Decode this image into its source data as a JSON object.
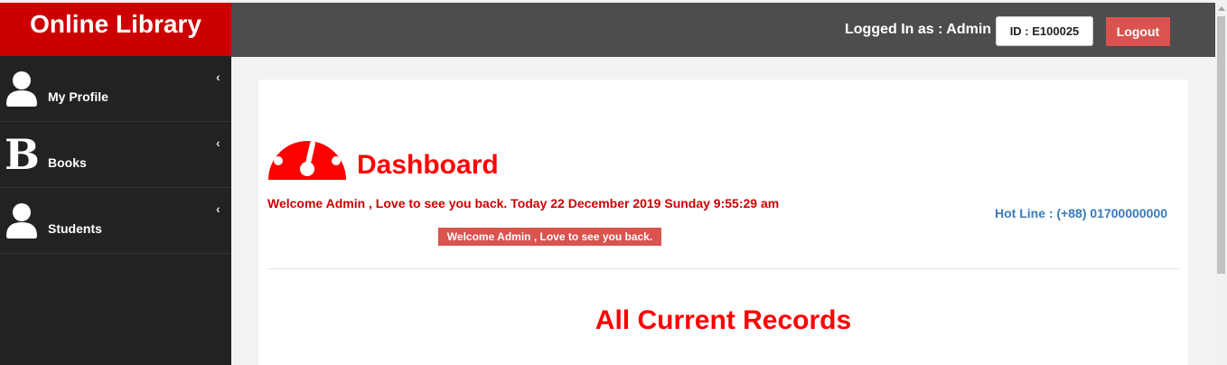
{
  "brand": {
    "title": "Online Library"
  },
  "header": {
    "logged_in_text": "Logged In as : Admin",
    "id_text": "ID : E100025",
    "logout_label": "Logout"
  },
  "sidebar": {
    "items": [
      {
        "label": "My Profile",
        "icon": "user-icon"
      },
      {
        "label": "Books",
        "icon": "b-letter-icon"
      },
      {
        "label": "Students",
        "icon": "user-icon"
      }
    ]
  },
  "main": {
    "dashboard_title": "Dashboard",
    "welcome_line": "Welcome Admin , Love to see you back. Today 22 December 2019 Sunday 9:55:29 am",
    "welcome_badge": "Welcome Admin , Love to see you back.",
    "hotline": "Hot Line : (+88) 01700000000",
    "records_heading": "All Current Records"
  },
  "colors": {
    "brand_red": "#cc0000",
    "title_red": "#ff0000",
    "header_gray": "#4d4d4d",
    "sidebar_dark": "#222222",
    "logout_red": "#d9534f",
    "hotline_blue": "#3a7ab8"
  }
}
